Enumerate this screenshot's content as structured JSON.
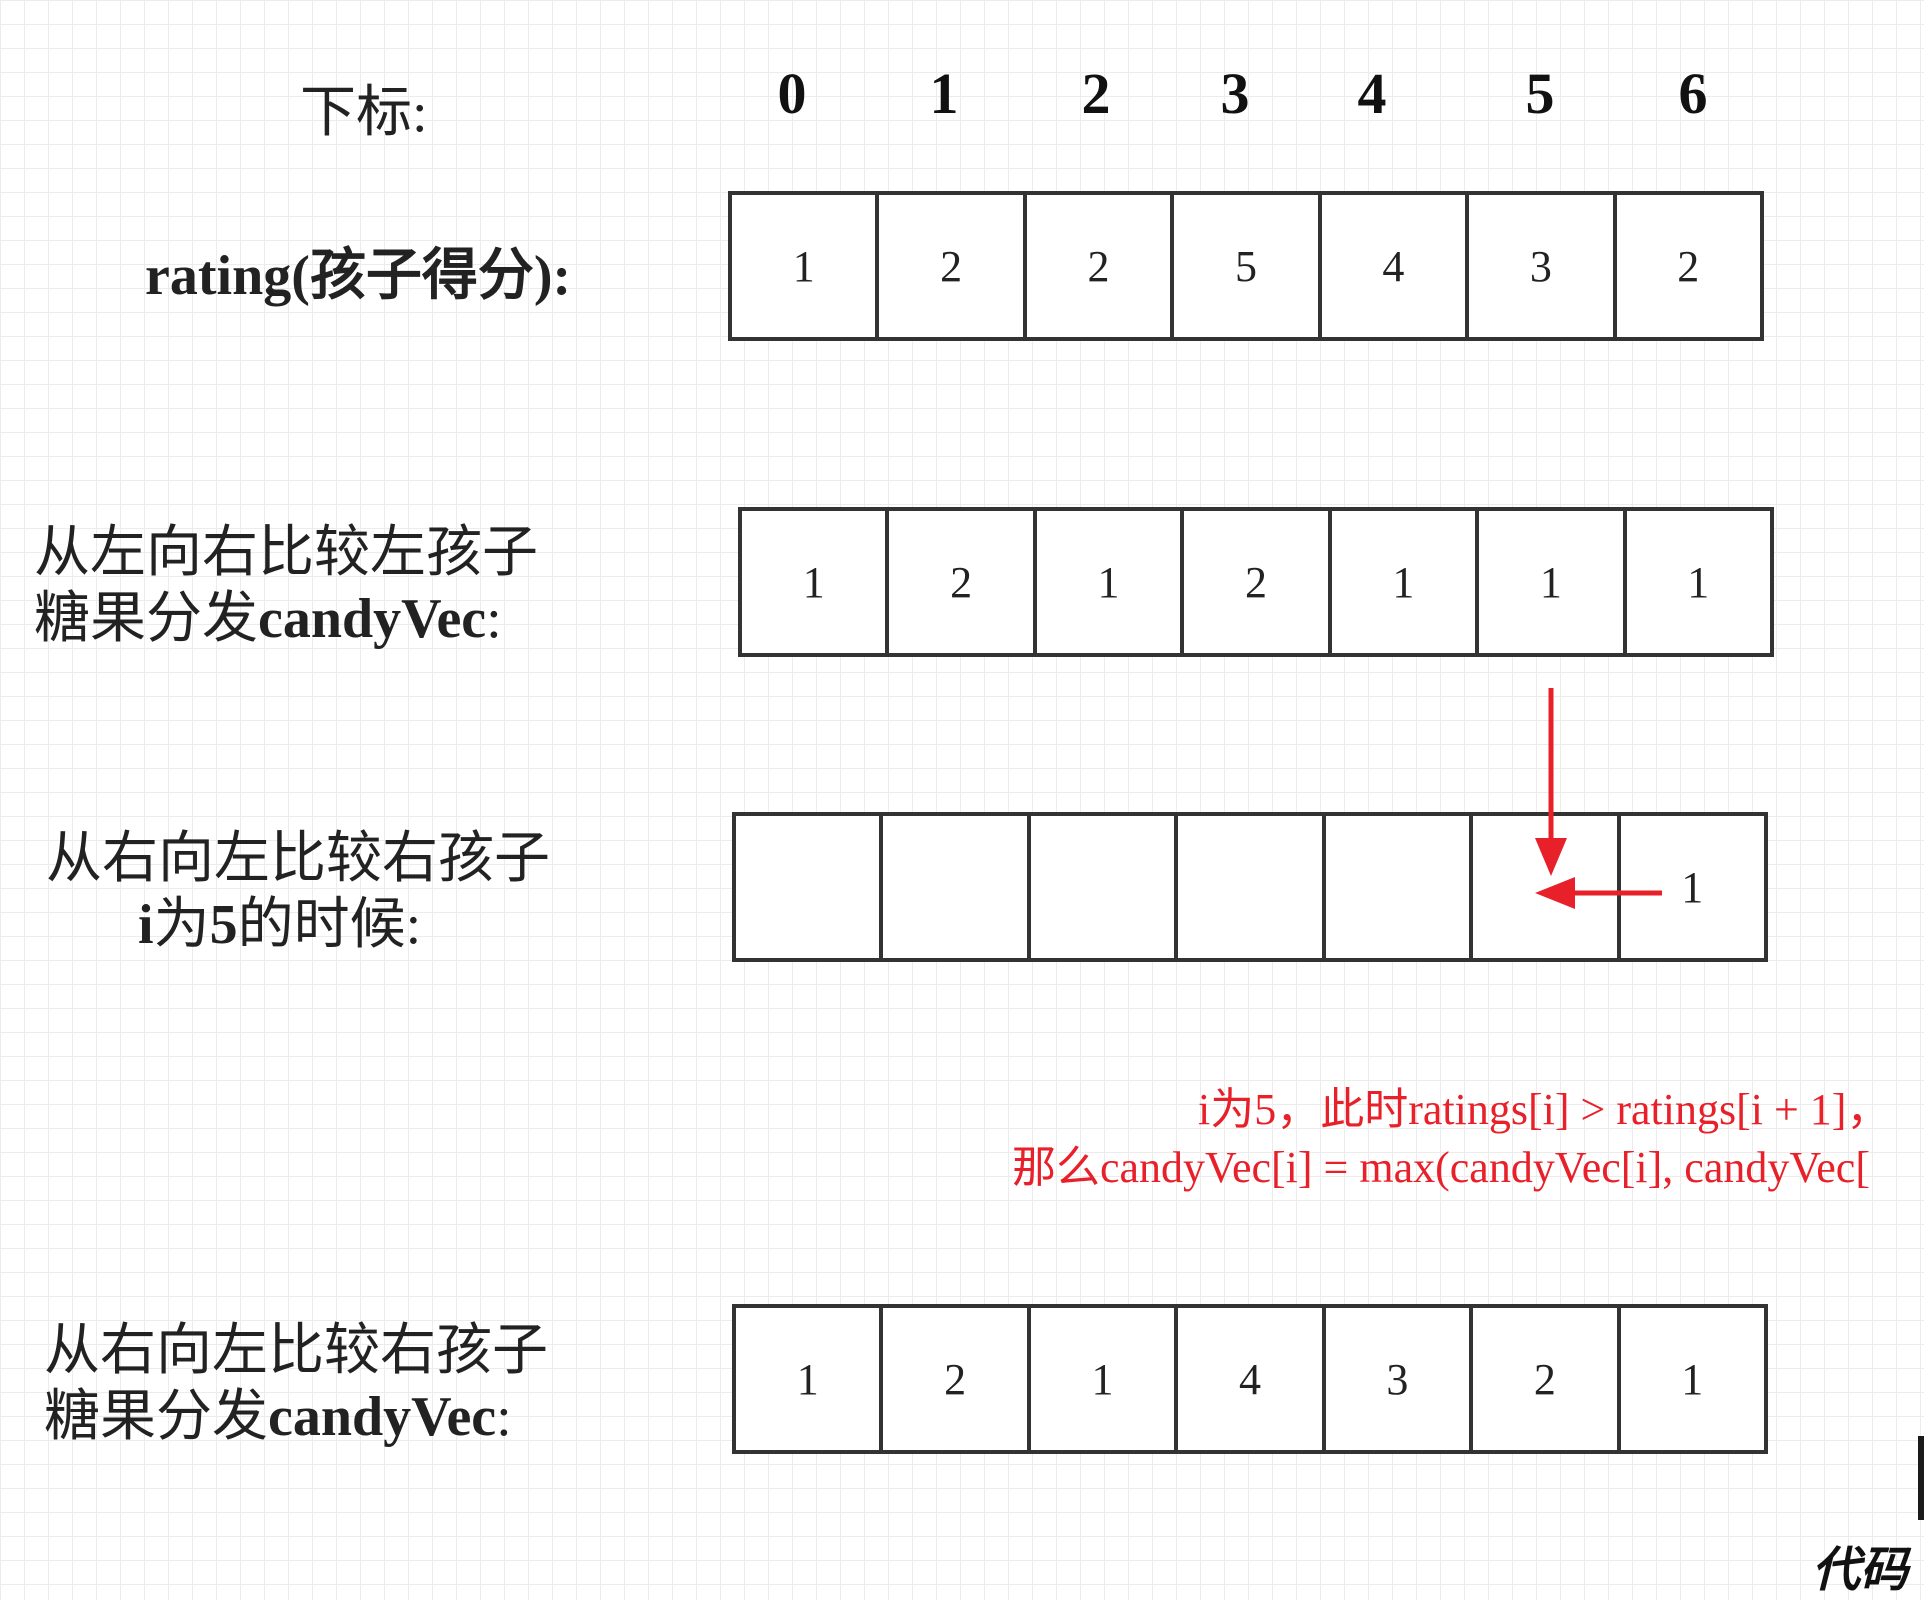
{
  "labels": {
    "index": "下标:",
    "rating": "rating(孩子得分):",
    "left_line1": "从左向右比较左孩子",
    "left_line2_prefix": "糖果分发",
    "left_line2_bold": "candyVec",
    "left_line2_suffix": ":",
    "mid_line1": "从右向左比较右孩子",
    "mid_line2_i": "i",
    "mid_line2_a": "为",
    "mid_line2_num": "5",
    "mid_line2_b": "的时候:",
    "right_line1": "从右向左比较右孩子",
    "right_line2_prefix": "糖果分发",
    "right_line2_bold": "candyVec",
    "right_line2_suffix": ":"
  },
  "indices": [
    "0",
    "1",
    "2",
    "3",
    "4",
    "5",
    "6"
  ],
  "rows": {
    "rating": [
      "1",
      "2",
      "2",
      "5",
      "4",
      "3",
      "2"
    ],
    "left_to_right": [
      "1",
      "2",
      "1",
      "2",
      "1",
      "1",
      "1"
    ],
    "i_equals_5": [
      "",
      "",
      "",
      "",
      "",
      "",
      "1"
    ],
    "right_to_left": [
      "1",
      "2",
      "1",
      "4",
      "3",
      "2",
      "1"
    ]
  },
  "note": {
    "line1": "i为5，此时ratings[i] > ratings[i + 1]，",
    "line2": "那么candyVec[i] = max(candyVec[i], candyVec["
  },
  "watermark": "代码",
  "colors": {
    "accent": "#e8202a",
    "border": "#333333",
    "grid": "#ececec"
  }
}
